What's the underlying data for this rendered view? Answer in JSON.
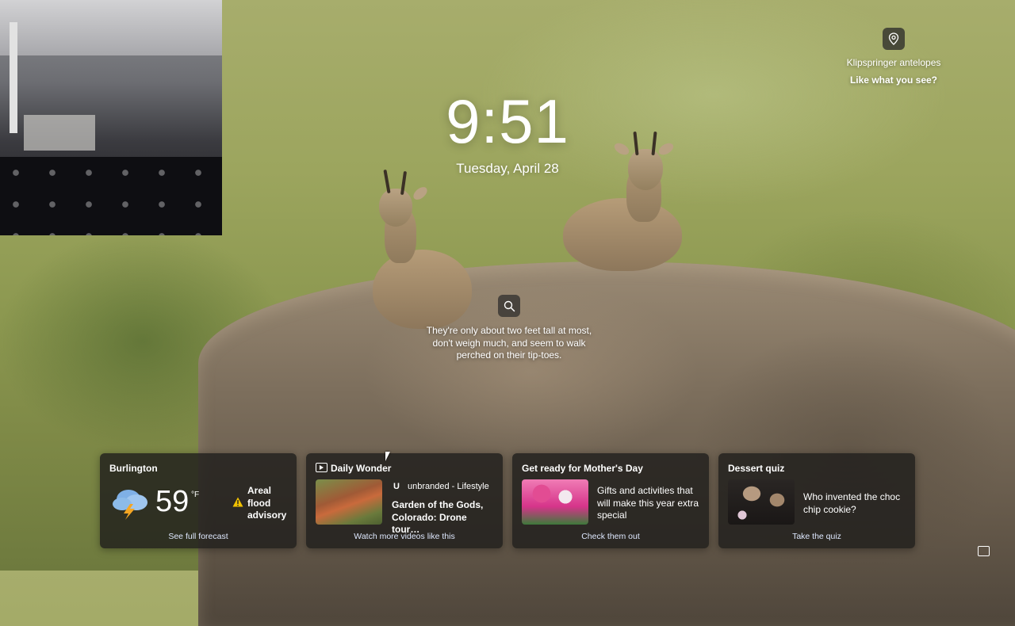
{
  "clock": {
    "time": "9:51",
    "date": "Tuesday, April 28"
  },
  "spotlight": {
    "title": "Klipspringer antelopes",
    "like": "Like what you see?"
  },
  "fact": {
    "text": "They're only about two feet tall at most, don't weigh much, and seem to walk perched on their tip-toes."
  },
  "cards": {
    "weather": {
      "city": "Burlington",
      "temp": "59",
      "unit": "°F",
      "alert": "Areal flood advisory",
      "link": "See full forecast"
    },
    "video": {
      "title": "Daily Wonder",
      "source_logo": "U",
      "source": "unbranded - Lifestyle",
      "headline": "Garden of the Gods, Colorado: Drone tour…",
      "link": "Watch more videos like this"
    },
    "mothers_day": {
      "title": "Get ready for Mother's Day",
      "text": "Gifts and activities that will make this year extra special",
      "link": "Check them out"
    },
    "quiz": {
      "title": "Dessert quiz",
      "text": "Who invented the choc chip cookie?",
      "link": "Take the quiz"
    }
  },
  "icons": {
    "location": "map-pin-icon",
    "search": "search-icon",
    "weather": "thunderstorm-icon",
    "alert": "warning-icon",
    "video": "video-icon",
    "tray": "feedback-icon"
  },
  "colors": {
    "card_bg": "#201e1c",
    "link": "#dfe9ff",
    "alert": "#f2c200"
  }
}
